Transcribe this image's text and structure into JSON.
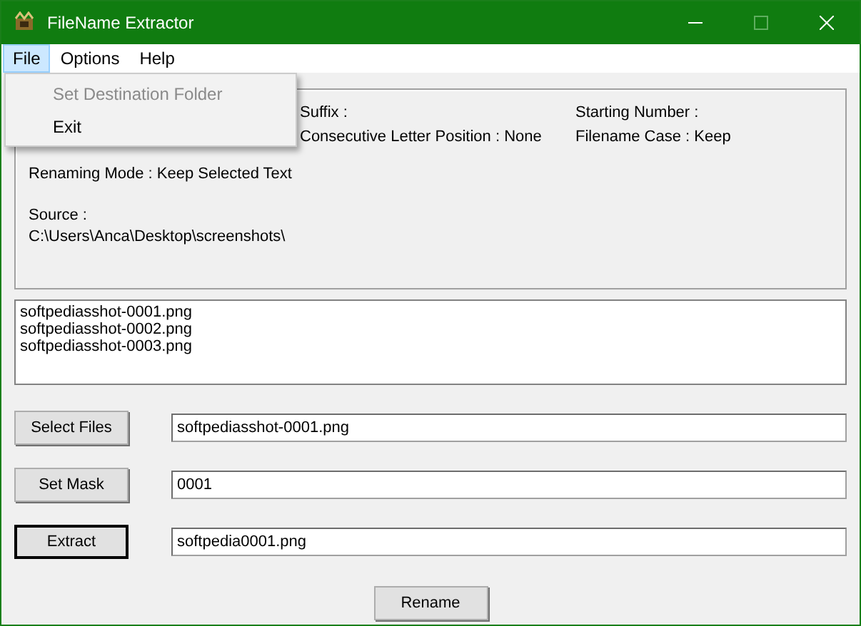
{
  "window": {
    "title": "FileName Extractor",
    "maximize_disabled": true
  },
  "menu_bar": [
    {
      "label": "File",
      "selected": true
    },
    {
      "label": "Options",
      "selected": false
    },
    {
      "label": "Help",
      "selected": false
    }
  ],
  "open_menu": [
    {
      "label": "Set Destination Folder",
      "disabled": true
    },
    {
      "label": "Exit",
      "disabled": false
    }
  ],
  "info": {
    "row_1": [
      "Suffix :",
      "Starting Number :"
    ],
    "row_2": [
      "Consecutive Letter Position :  None",
      "Filename Case : Keep"
    ],
    "renaming_mode": "Renaming Mode :  Keep Selected Text",
    "source_label": "Source :",
    "source_path": "C:\\Users\\Anca\\Desktop\\screenshots\\"
  },
  "files": [
    "softpediasshot-0001.png",
    "softpediasshot-0002.png",
    "softpediasshot-0003.png"
  ],
  "actions": [
    {
      "label": "Select Files",
      "value": "softpediasshot-0001.png",
      "focused": false
    },
    {
      "label": "Set Mask",
      "value": "0001",
      "focused": false
    },
    {
      "label": "Extract",
      "value": "softpedia0001.png",
      "focused": true
    }
  ],
  "rename_button": "Rename"
}
